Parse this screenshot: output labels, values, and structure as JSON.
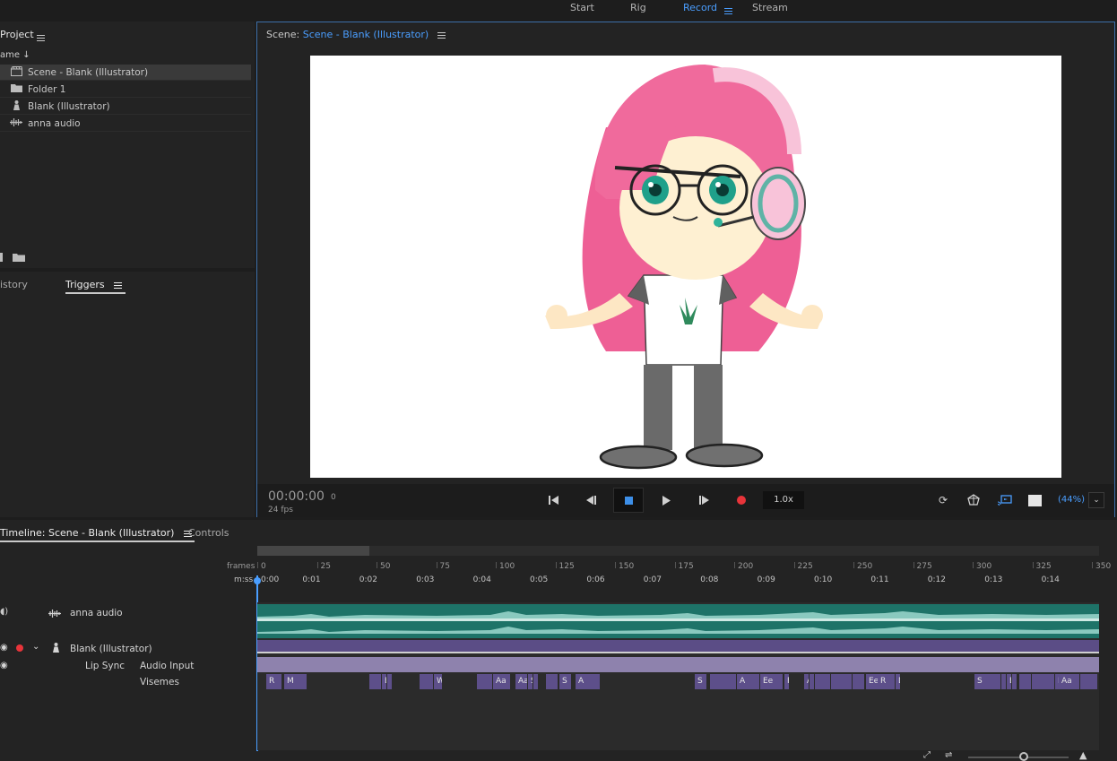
{
  "nav": {
    "start": "Start",
    "rig": "Rig",
    "record": "Record",
    "stream": "Stream"
  },
  "project": {
    "title": "Project",
    "column": "ame",
    "items": [
      {
        "icon": "scene-icon",
        "label": "Scene - Blank (Illustrator)"
      },
      {
        "icon": "folder-icon",
        "label": "Folder 1"
      },
      {
        "icon": "puppet-icon",
        "label": "Blank (Illustrator)"
      },
      {
        "icon": "audio-icon",
        "label": "anna audio"
      }
    ]
  },
  "triggers": {
    "history": "istory",
    "triggers": "Triggers"
  },
  "scene": {
    "prefix": "Scene:",
    "name": "Scene - Blank (Illustrator)",
    "time": "00:00:00",
    "frame": "0",
    "fps": "24 fps",
    "speed": "1.0x",
    "zoom": "(44%)"
  },
  "timeline": {
    "title": "Timeline: Scene - Blank (Illustrator)",
    "controls": "Controls",
    "frames_label": "frames",
    "mss_label": "m:ss",
    "frames": [
      "0",
      "25",
      "50",
      "75",
      "100",
      "125",
      "150",
      "175",
      "200",
      "225",
      "250",
      "275",
      "300",
      "325",
      "350"
    ],
    "times": [
      "0:00",
      "0:01",
      "0:02",
      "0:03",
      "0:04",
      "0:05",
      "0:06",
      "0:07",
      "0:08",
      "0:09",
      "0:10",
      "0:11",
      "0:12",
      "0:13",
      "0:14"
    ],
    "audio_track": "anna audio",
    "puppet_track": "Blank (Illustrator)",
    "lip_sync": "Lip Sync",
    "audio_input": "Audio Input",
    "visemes": "Visemes",
    "viseme_labels": [
      "R",
      "M",
      "",
      "E",
      "",
      "",
      "W",
      "",
      "Aa",
      "Aa",
      "S",
      "",
      "",
      "S",
      "A",
      "S",
      "",
      "A",
      "Ee",
      "R",
      "Aa",
      "",
      "",
      "",
      "",
      "Ee",
      "R",
      "D",
      "S",
      "",
      "Ee",
      "",
      "",
      "",
      "E",
      "Aa",
      "",
      "W-O",
      "Ee"
    ]
  },
  "colors": {
    "accent": "#4a9eff",
    "audio_wave": "#1e7368",
    "puppet_bar": "#5b4d86",
    "input_bar": "#8e82ad",
    "viseme": "#5d4f8a"
  }
}
